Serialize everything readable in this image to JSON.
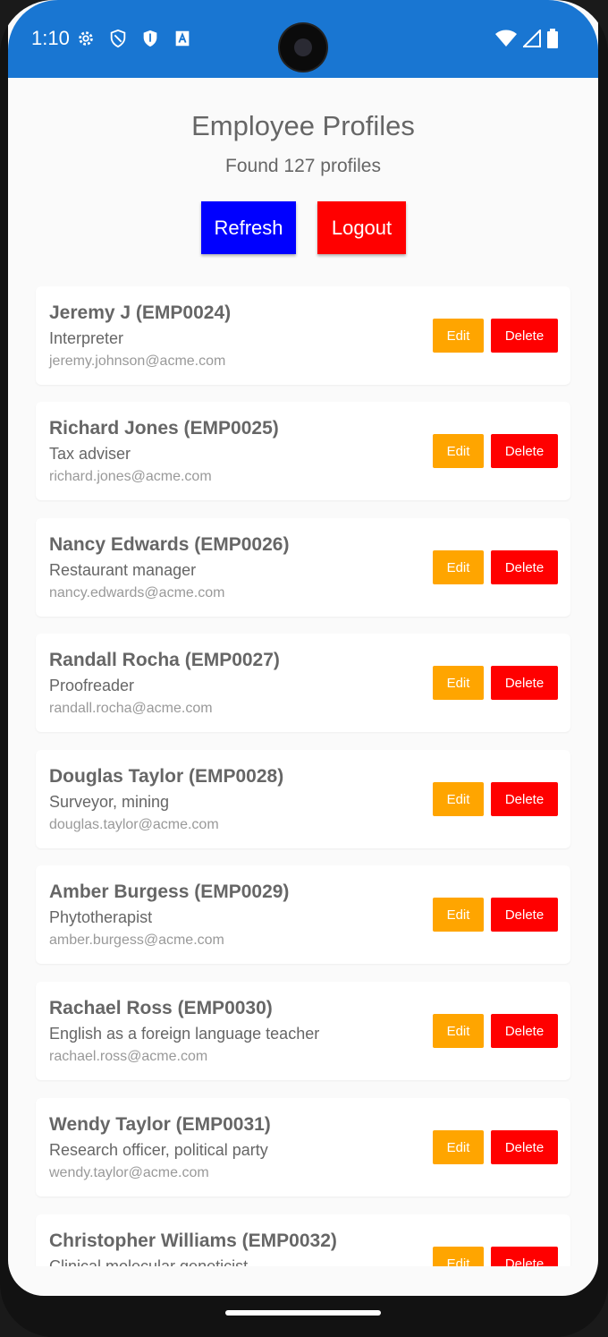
{
  "status": {
    "time": "1:10",
    "icons_left": [
      "settings-icon",
      "shield-outline-icon",
      "shield-icon",
      "text-a-icon"
    ],
    "icons_right": [
      "wifi-icon",
      "cell-signal-icon",
      "battery-icon"
    ]
  },
  "header": {
    "title": "Employee Profiles",
    "found": "Found 127 profiles",
    "refresh_label": "Refresh",
    "logout_label": "Logout"
  },
  "colors": {
    "status_bar": "#1976d2",
    "refresh": "#0000ff",
    "logout": "#ff0000",
    "edit": "#ffa500",
    "delete": "#ff0000"
  },
  "employees": [
    {
      "name": "Jeremy J (EMP0024)",
      "role": "Interpreter",
      "email": "jeremy.johnson@acme.com",
      "edit": "Edit",
      "delete": "Delete"
    },
    {
      "name": "Richard Jones (EMP0025)",
      "role": "Tax adviser",
      "email": "richard.jones@acme.com",
      "edit": "Edit",
      "delete": "Delete"
    },
    {
      "name": "Nancy Edwards (EMP0026)",
      "role": "Restaurant manager",
      "email": "nancy.edwards@acme.com",
      "edit": "Edit",
      "delete": "Delete"
    },
    {
      "name": "Randall Rocha (EMP0027)",
      "role": "Proofreader",
      "email": "randall.rocha@acme.com",
      "edit": "Edit",
      "delete": "Delete"
    },
    {
      "name": "Douglas Taylor (EMP0028)",
      "role": "Surveyor, mining",
      "email": "douglas.taylor@acme.com",
      "edit": "Edit",
      "delete": "Delete"
    },
    {
      "name": "Amber Burgess (EMP0029)",
      "role": "Phytotherapist",
      "email": "amber.burgess@acme.com",
      "edit": "Edit",
      "delete": "Delete"
    },
    {
      "name": "Rachael Ross (EMP0030)",
      "role": "English as a foreign language teacher",
      "email": "rachael.ross@acme.com",
      "edit": "Edit",
      "delete": "Delete"
    },
    {
      "name": "Wendy Taylor (EMP0031)",
      "role": "Research officer, political party",
      "email": "wendy.taylor@acme.com",
      "edit": "Edit",
      "delete": "Delete"
    },
    {
      "name": "Christopher Williams (EMP0032)",
      "role": "Clinical molecular geneticist",
      "email": "",
      "edit": "Edit",
      "delete": "Delete"
    }
  ]
}
